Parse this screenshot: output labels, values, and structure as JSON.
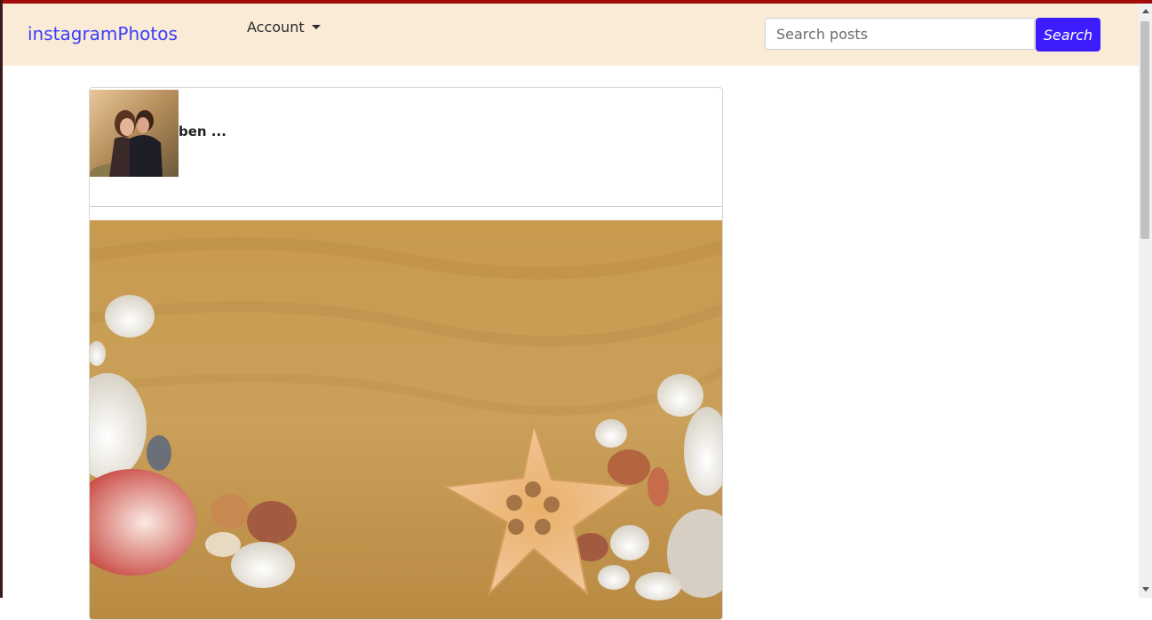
{
  "navbar": {
    "brand": "instagramPhotos",
    "account_label": "Account",
    "search_placeholder": "Search posts",
    "search_button_label": "Search"
  },
  "post": {
    "username": "ben ..."
  },
  "colors": {
    "top_stripe": "#a30a0a",
    "navbar_bg": "#f9ebd6",
    "brand": "#3d3dff",
    "search_button": "#3d1dfd"
  },
  "icons": {
    "account_caret": "caret-down-icon"
  }
}
